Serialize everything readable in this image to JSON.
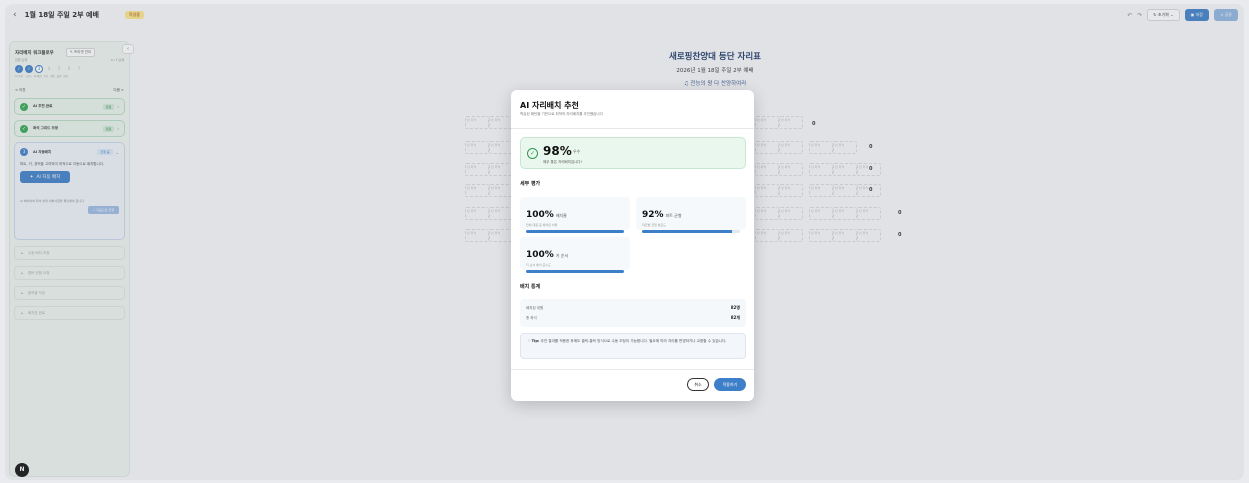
{
  "header": {
    "back_icon": "back-arrow-icon",
    "title": "1월 18일 주일 2부 예배",
    "draft_badge": "작성중",
    "undo_icon": "↶",
    "redo_icon": "↷",
    "reset_label": "초기화",
    "save_label": "저장",
    "share_label": "공유"
  },
  "sidebar": {
    "title": "자리배치 워크플로우",
    "preset_label": "프리셋 관리",
    "sub_left": "진행 단계",
    "sub_right": "3 / 7 단계",
    "steps": [
      "✓",
      "✓",
      "3",
      "4",
      "5",
      "6",
      "7"
    ],
    "step_labels": [
      "AI 추천",
      "그리드",
      "AI 배치",
      "수동",
      "확인",
      "출력",
      "완료"
    ],
    "nav_prev": "< 이전",
    "nav_next": "다음 >",
    "cards": [
      {
        "label": "AI 추천 완료",
        "badge": "완료"
      },
      {
        "label": "좌석 그리드 조정",
        "badge": "완료"
      }
    ],
    "active": {
      "num": "3",
      "label": "AI 자동배치",
      "badge": "진행 중",
      "desc": "파트, 키, 경력을 고려하여 최적으로 자동으로 배치합니다.",
      "button": "AI 자동 배치",
      "note": "AI 배치하여 좌석 여러 세부사항을 확인해야 합니다",
      "next": "다음으로 진행"
    },
    "locked": [
      "수동 배치 조정",
      "멤버 컨펌 요청",
      "출력물 작성",
      "배치표 완료"
    ]
  },
  "background": {
    "title": "새로핑찬양대 등단 자리표",
    "subtitle": "2026년 1월 18일 주일 2부 예배",
    "song": "♫ 전능의 왕 다 찬양하여라",
    "seat_label": "빈 좌석",
    "row_counts": [
      "0",
      "0",
      "0",
      "0",
      "0"
    ]
  },
  "modal": {
    "title": "AI 자리배치 추천",
    "desc": "학습된 패턴을 기반으로 최적의 자리배치를 추천했습니다",
    "score_value": "98%",
    "score_grade": "우수",
    "score_msg": "매우 좋은 자리배치입니다!",
    "detail_title": "세부 평가",
    "metrics": [
      {
        "value": "100%",
        "name": "배치율",
        "desc": "전체 대원 중 배치된 비율",
        "fill": 1.0
      },
      {
        "value": "92%",
        "name": "파트 균형",
        "desc": "파트별 균형 분포도",
        "fill": 0.92
      },
      {
        "value": "100%",
        "name": "키 순서",
        "desc": "키 순서 배치 준수도",
        "fill": 1.0
      }
    ],
    "stats_title": "배치 통계",
    "stats": [
      {
        "label": "배치된 대원",
        "value": "82명"
      },
      {
        "label": "총 좌석",
        "value": "82개"
      }
    ],
    "tip_label": "Tip:",
    "tip_text": "추천 결과를 적용한 후에도 클릭-클릭 방식으로 수동 조정이 가능합니다. 필요에 따라 자리를 변경하거나 교환할 수 있습니다.",
    "cancel_label": "취소",
    "apply_label": "적용하기"
  },
  "avatar": "N",
  "colors": {
    "primary": "#3e7fc9",
    "success": "#34a853",
    "title_navy": "#1e3a6b"
  }
}
